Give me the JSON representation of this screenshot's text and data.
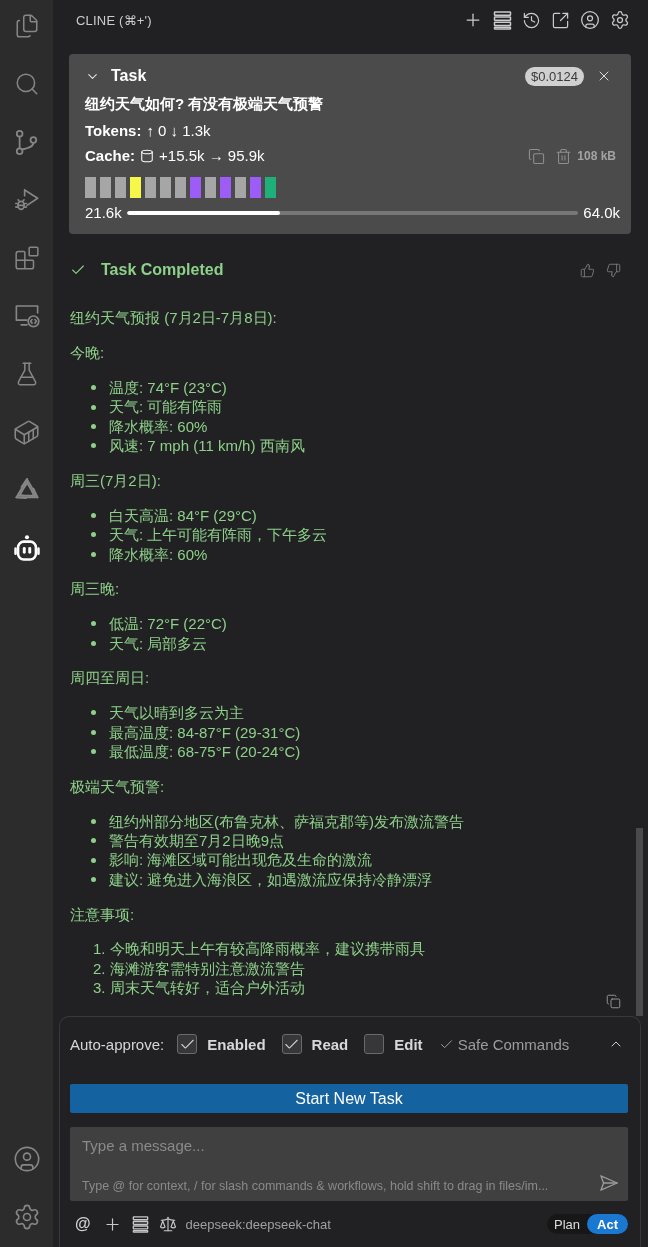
{
  "activity_bar": {
    "top": [
      {
        "selected": false
      },
      {
        "selected": false
      },
      {
        "selected": false
      },
      {
        "selected": false
      },
      {
        "selected": false
      },
      {
        "selected": false
      },
      {
        "selected": false
      },
      {
        "selected": false
      },
      {
        "selected": false
      },
      {
        "selected": true
      }
    ],
    "bottom": [
      {
        "selected": false
      },
      {
        "selected": false
      }
    ]
  },
  "header": {
    "title": "CLINE (⌘+')"
  },
  "task": {
    "expanded": true,
    "title": "Task",
    "cost": "$0.0124",
    "prompt": "纽约天气如何? 有没有极端天气预警",
    "tokens": {
      "label": "Tokens:",
      "value": "↑ 0 ↓ 1.3k"
    },
    "cache": {
      "label": "Cache:",
      "value": "+15.5k → 95.9k",
      "size": "108 kB"
    },
    "timeline": [
      {
        "color": "#a6a6a6"
      },
      {
        "color": "#a6a6a6"
      },
      {
        "color": "#a6a6a6"
      },
      {
        "color": "#f7f74a"
      },
      {
        "color": "#a6a6a6"
      },
      {
        "color": "#a6a6a6"
      },
      {
        "color": "#a6a6a6"
      },
      {
        "color": "#9d5cf5"
      },
      {
        "color": "#a6a6a6"
      },
      {
        "color": "#9d5cf5"
      },
      {
        "color": "#a6a6a6"
      },
      {
        "color": "#9d5cf5"
      },
      {
        "color": "#1fb079"
      }
    ],
    "context": {
      "used": "21.6k",
      "limit": "64.0k",
      "level": 0.34
    }
  },
  "completion": {
    "title": "Task Completed"
  },
  "response": [
    {
      "kind": "paragraph",
      "text": "纽约天气预报 (7月2日-7月8日):"
    },
    {
      "kind": "paragraph",
      "text": "今晚:"
    },
    {
      "kind": "bullets",
      "items": [
        "温度: 74°F (23°C)",
        "天气: 可能有阵雨",
        "降水概率: 60%",
        "风速: 7 mph (11 km/h) 西南风"
      ]
    },
    {
      "kind": "paragraph",
      "text": "周三(7月2日):"
    },
    {
      "kind": "bullets",
      "items": [
        "白天高温: 84°F (29°C)",
        "天气: 上午可能有阵雨，下午多云",
        "降水概率: 60%"
      ]
    },
    {
      "kind": "paragraph",
      "text": "周三晚:"
    },
    {
      "kind": "bullets",
      "items": [
        "低温: 72°F (22°C)",
        "天气: 局部多云"
      ]
    },
    {
      "kind": "paragraph",
      "text": "周四至周日:"
    },
    {
      "kind": "bullets",
      "items": [
        "天气以晴到多云为主",
        "最高温度: 84-87°F (29-31°C)",
        "最低温度: 68-75°F (20-24°C)"
      ]
    },
    {
      "kind": "paragraph",
      "text": "极端天气预警:"
    },
    {
      "kind": "bullets",
      "items": [
        "纽约州部分地区(布鲁克林、萨福克郡等)发布激流警告",
        "警告有效期至7月2日晚9点",
        "影响: 海滩区域可能出现危及生命的激流",
        "建议: 避免进入海浪区，如遇激流应保持冷静漂浮"
      ]
    },
    {
      "kind": "paragraph",
      "text": "注意事项:"
    },
    {
      "kind": "numbered",
      "items": [
        {
          "number": "1.",
          "text": "今晚和明天上午有较高降雨概率，建议携带雨具"
        },
        {
          "number": "2.",
          "text": "海滩游客需特别注意激流警告"
        },
        {
          "number": "3.",
          "text": "周末天气转好，适合户外活动"
        }
      ]
    }
  ],
  "auto_approve": {
    "label": "Auto-approve:",
    "options": [
      {
        "kind": "checkbox",
        "label": "Enabled",
        "checked": true
      },
      {
        "kind": "checkbox",
        "label": "Read",
        "checked": true
      },
      {
        "kind": "checkbox",
        "label": "Edit",
        "checked": false
      },
      {
        "kind": "tick",
        "label": "Safe Commands",
        "checked": true
      }
    ]
  },
  "start_button": "Start New Task",
  "input": {
    "placeholder": "Type a message...",
    "hint": "Type @ for context, / for slash commands & workflows, hold shift to drag in files/im..."
  },
  "footer": {
    "at": "@",
    "model": "deepseek:deepseek-chat",
    "modes": [
      {
        "label": "Plan",
        "selected": false
      },
      {
        "label": "Act",
        "selected": true
      }
    ]
  }
}
